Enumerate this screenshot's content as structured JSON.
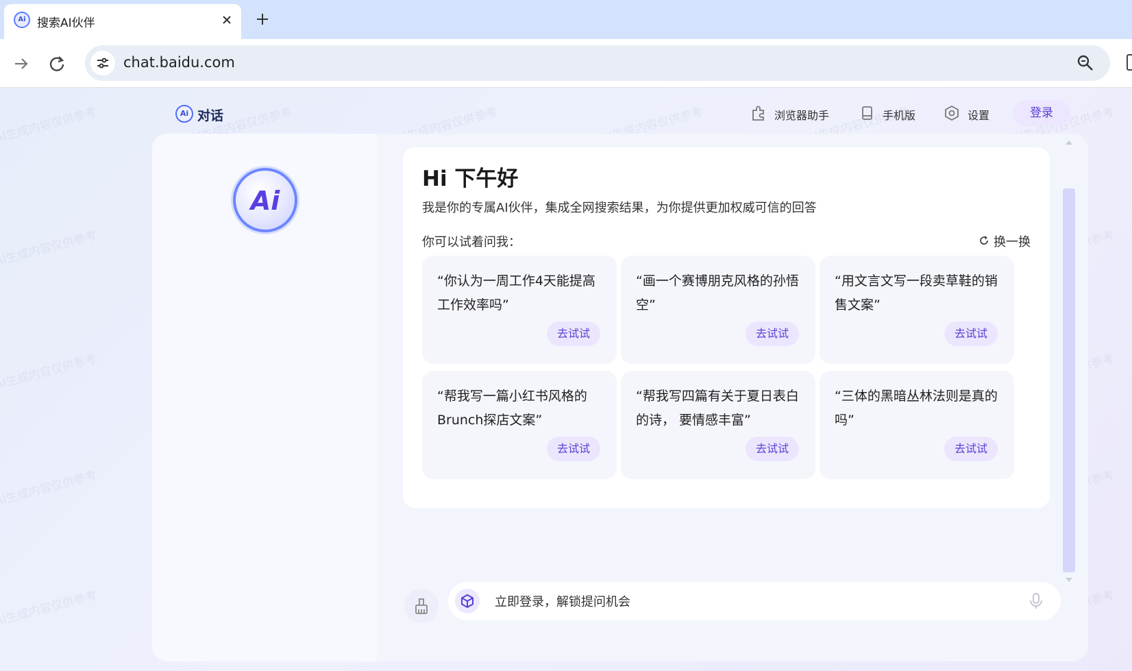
{
  "browser": {
    "tab_title": "搜索AI伙伴",
    "tab_favicon_text": "Ai",
    "url": "chat.baidu.com"
  },
  "icons": {
    "tab_favicon": "ai-favicon-icon",
    "close": "close-icon",
    "new_tab": "plus-icon",
    "forward": "arrow-right-icon",
    "reload": "reload-icon",
    "site_info": "tune-icon",
    "zoom": "zoom-icon",
    "plugin": "puzzle-icon",
    "mobile": "phone-icon",
    "settings": "gear-icon",
    "refresh": "refresh-icon",
    "clear": "broom-icon",
    "input_logo": "cube-icon",
    "mic": "microphone-icon"
  },
  "header": {
    "brand_logo_text": "Ai",
    "brand_title": "对话",
    "nav": [
      {
        "label": "浏览器助手"
      },
      {
        "label": "手机版"
      },
      {
        "label": "设置"
      }
    ],
    "login_label": "登录"
  },
  "sidebar": {
    "avatar_text": "Ai"
  },
  "welcome": {
    "greeting": "Hi 下午好",
    "intro": "我是你的专属AI伙伴，集成全网搜索结果，为你提供更加权威可信的回答",
    "try_label": "你可以试着问我：",
    "refresh_label": "换一换",
    "try_button_label": "去试试",
    "suggestions": [
      {
        "text": "“你认为一周工作4天能提高工作效率吗”"
      },
      {
        "text": "“画一个赛博朋克风格的孙悟空”"
      },
      {
        "text": "“用文言文写一段卖草鞋的销售文案”"
      },
      {
        "text": "“帮我写一篇小红书风格的Brunch探店文案”"
      },
      {
        "text": "“帮我写四篇有关于夏日表白的诗， 要情感丰富”"
      },
      {
        "text": "“三体的黑暗丛林法则是真的吗”"
      }
    ]
  },
  "composer": {
    "placeholder": "立即登录，解锁提问机会"
  },
  "watermark": "AI生成内容仅供参考",
  "colors": {
    "accent": "#5b3fd3",
    "accent_bg": "#ebe6fd",
    "tab_strip": "#d3e3fd"
  }
}
